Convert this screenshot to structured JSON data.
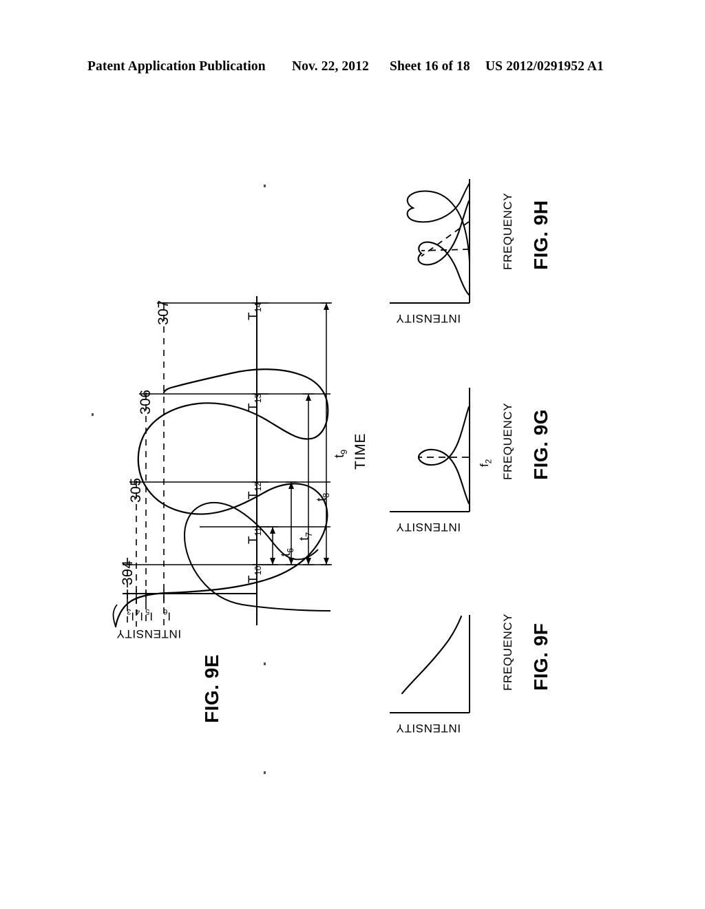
{
  "header": {
    "publication": "Patent Application Publication",
    "date": "Nov. 22, 2012",
    "sheet": "Sheet 16 of 18",
    "patent_number": "US 2012/0291952 A1"
  },
  "figures": [
    {
      "id": "fig-9e",
      "title": "FIG. 9E",
      "x_axis_label": "TIME",
      "y_axis_label": "INTENSITY",
      "time_ticks": [
        "T10",
        "T11",
        "T12",
        "T13",
        "T14"
      ],
      "time_ticks_display": [
        "T",
        "T",
        "T",
        "T",
        "T"
      ],
      "time_subs": [
        "10",
        "11",
        "12",
        "13",
        "14"
      ],
      "intensity_ticks": [
        "I3",
        "I4",
        "I5",
        "I6"
      ],
      "intensity_letters": [
        "I",
        "I",
        "I",
        "I"
      ],
      "intensity_subs": [
        "3",
        "4",
        "5",
        "6"
      ],
      "span_labels": [
        "t6",
        "t7",
        "t8",
        "t9"
      ],
      "span_letters": [
        "t",
        "t",
        "t",
        "t"
      ],
      "span_subs": [
        "6",
        "7",
        "8",
        "9"
      ],
      "reference_numerals": [
        "304",
        "305",
        "306",
        "307"
      ]
    },
    {
      "id": "fig-9f",
      "title": "FIG. 9F",
      "x_axis_label": "FREQUENCY",
      "y_axis_label": "INTENSITY",
      "curve_type": "monotonic-rising"
    },
    {
      "id": "fig-9g",
      "title": "FIG. 9G",
      "x_axis_label": "FREQUENCY",
      "y_axis_label": "INTENSITY",
      "marker_label": "f2",
      "marker_letter": "f",
      "marker_sub": "2",
      "curve_type": "single-gaussian-peak"
    },
    {
      "id": "fig-9h",
      "title": "FIG. 9H",
      "x_axis_label": "FREQUENCY",
      "y_axis_label": "INTENSITY",
      "curve_type": "split-double-peak"
    }
  ],
  "chart_data": [
    {
      "type": "line",
      "id": "fig-9e",
      "title": "FIG. 9E",
      "xlabel": "TIME",
      "ylabel": "INTENSITY",
      "grid": false,
      "legend": "none",
      "x_tick_labels": [
        "T10",
        "T11",
        "T12",
        "T13",
        "T14"
      ],
      "y_tick_labels": [
        "I3",
        "I4",
        "I5",
        "I6"
      ],
      "annotations": [
        "304",
        "305",
        "306",
        "307",
        "t6",
        "t7",
        "t8",
        "t9"
      ],
      "description": "Oscillating intensity-vs-time trace with three peaks of increasing amplitude; dashed horizontal guides at I3..I6 mark successive peak baselines; spans t6 (T10-T11), t7 (T10-T12), t8 (T10-T13), t9 (T10-T14).",
      "series": [
        {
          "name": "intensity",
          "x": [
            0,
            0.035,
            0.08,
            0.13,
            0.185,
            0.25,
            0.31,
            0.37,
            0.43,
            0.5,
            0.57,
            0.63,
            0.7,
            0.765,
            0.825,
            0.88,
            0.93,
            0.97,
            1.0
          ],
          "y": [
            0.08,
            0.22,
            0.3,
            0.31,
            0.305,
            0.52,
            0.78,
            0.84,
            0.73,
            0.42,
            0.3,
            0.46,
            0.78,
            0.93,
            0.9,
            0.7,
            0.55,
            0.72,
            0.97
          ]
        }
      ],
      "span_bars": [
        {
          "label": "t6",
          "from": "T10",
          "to": "T11"
        },
        {
          "label": "t7",
          "from": "T10",
          "to": "T12"
        },
        {
          "label": "t8",
          "from": "T10",
          "to": "T13"
        },
        {
          "label": "t9",
          "from": "T10",
          "to": "T14"
        }
      ]
    },
    {
      "type": "line",
      "id": "fig-9f",
      "title": "FIG. 9F",
      "xlabel": "FREQUENCY",
      "ylabel": "INTENSITY",
      "grid": false,
      "legend": "none",
      "description": "Monotonically rising intensity with frequency; single smooth upward-curving trace, no peak.",
      "series": [
        {
          "name": "intensity",
          "x": [
            0.0,
            0.12,
            0.25,
            0.4,
            0.55,
            0.7,
            0.85,
            1.0
          ],
          "y": [
            0.1,
            0.2,
            0.32,
            0.45,
            0.58,
            0.72,
            0.86,
            1.0
          ]
        }
      ]
    },
    {
      "type": "line",
      "id": "fig-9g",
      "title": "FIG. 9G",
      "xlabel": "FREQUENCY",
      "ylabel": "INTENSITY",
      "grid": false,
      "legend": "none",
      "annotations": [
        "f2"
      ],
      "description": "Single symmetric Gaussian intensity peak centred at frequency f2; dashed horizontal line marks the peak centre.",
      "series": [
        {
          "name": "intensity",
          "x": [
            0.0,
            0.1,
            0.22,
            0.32,
            0.4,
            0.46,
            0.5,
            0.54,
            0.6,
            0.68,
            0.78,
            0.9,
            1.0
          ],
          "y": [
            0.02,
            0.04,
            0.1,
            0.26,
            0.55,
            0.85,
            1.0,
            0.85,
            0.55,
            0.26,
            0.1,
            0.04,
            0.02
          ]
        }
      ],
      "markers": [
        {
          "label": "f2",
          "position": 0.5,
          "style": "dashed"
        }
      ]
    },
    {
      "type": "line",
      "id": "fig-9h",
      "title": "FIG. 9H",
      "xlabel": "FREQUENCY",
      "ylabel": "INTENSITY",
      "grid": false,
      "legend": "none",
      "description": "Split / double-humped intensity profile with a central dip; two dashed straight lines cross near the dip showing the split of the single peak into two.",
      "series": [
        {
          "name": "intensity",
          "x": [
            0.0,
            0.08,
            0.18,
            0.27,
            0.34,
            0.4,
            0.45,
            0.5,
            0.55,
            0.6,
            0.66,
            0.73,
            0.82,
            0.92,
            1.0
          ],
          "y": [
            0.02,
            0.05,
            0.14,
            0.4,
            0.72,
            0.88,
            0.84,
            0.76,
            0.84,
            0.88,
            0.72,
            0.4,
            0.14,
            0.05,
            0.02
          ]
        }
      ],
      "markers": [
        {
          "label": "",
          "style": "dashed-cross-1"
        },
        {
          "label": "",
          "style": "dashed-cross-2"
        }
      ]
    }
  ]
}
